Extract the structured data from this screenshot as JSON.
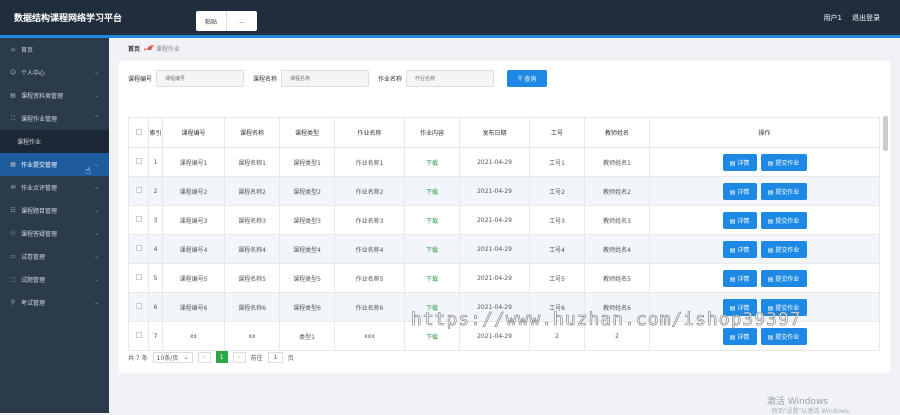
{
  "topbar": {
    "title": "数据结构课程网络学习平台",
    "tabs": [
      "粘贴",
      "..."
    ],
    "user": "用户1",
    "logout": "退出登录"
  },
  "sidebar": {
    "items": [
      {
        "label": "首页",
        "icon": "home-icon",
        "glyph": "⌂"
      },
      {
        "label": "个人中心",
        "icon": "user-icon",
        "glyph": "☺",
        "chev": "⌄"
      },
      {
        "label": "课程资料类管理",
        "icon": "book-icon",
        "glyph": "▤",
        "chev": "⌄"
      },
      {
        "label": "课程作业管理",
        "icon": "task-icon",
        "glyph": "⛶",
        "chev": "⌃"
      },
      {
        "label": "课程作业",
        "sub": true
      },
      {
        "label": "作业提交管理",
        "icon": "submit-icon",
        "glyph": "▦",
        "chev": "⌄",
        "active": true
      },
      {
        "label": "作业点评管理",
        "icon": "comment-icon",
        "glyph": "✉",
        "chev": "⌄"
      },
      {
        "label": "课程题目管理",
        "icon": "question-icon",
        "glyph": "☷",
        "chev": "⌄"
      },
      {
        "label": "课程答疑管理",
        "icon": "qa-icon",
        "glyph": "⚇",
        "chev": "⌄"
      },
      {
        "label": "试卷管理",
        "icon": "paper-icon",
        "glyph": "▭",
        "chev": "⌄"
      },
      {
        "label": "试题管理",
        "icon": "exam-icon",
        "glyph": "⬚",
        "chev": "⌄"
      },
      {
        "label": "考试管理",
        "icon": "test-icon",
        "glyph": "⚲",
        "chev": "⌄"
      }
    ]
  },
  "breadcrumb": {
    "home": "首页",
    "sep": "𝓜",
    "current": "课程作业"
  },
  "search": {
    "course_no_label": "课程编号",
    "course_no_ph": "课程编号",
    "course_name_label": "课程名称",
    "course_name_ph": "课程名称",
    "hw_name_label": "作业名称",
    "hw_name_ph": "作业名称",
    "btn": "查询",
    "btn_icon": "⚲"
  },
  "table": {
    "headers": [
      "",
      "索引",
      "课程编号",
      "课程名称",
      "课程类型",
      "作业名称",
      "作业内容",
      "发布日期",
      "工号",
      "教师姓名",
      "操作"
    ],
    "rows": [
      [
        "1",
        "课程编号1",
        "课程名称1",
        "课程类型1",
        "作业名称1",
        "下载",
        "2021-04-29",
        "工号1",
        "教师姓名1"
      ],
      [
        "2",
        "课程编号2",
        "课程名称2",
        "课程类型2",
        "作业名称2",
        "下载",
        "2021-04-29",
        "工号2",
        "教师姓名2"
      ],
      [
        "3",
        "课程编号3",
        "课程名称3",
        "课程类型3",
        "作业名称3",
        "下载",
        "2021-04-29",
        "工号3",
        "教师姓名3"
      ],
      [
        "4",
        "课程编号4",
        "课程名称4",
        "课程类型4",
        "作业名称4",
        "下载",
        "2021-04-29",
        "工号4",
        "教师姓名4"
      ],
      [
        "5",
        "课程编号5",
        "课程名称5",
        "课程类型5",
        "作业名称5",
        "下载",
        "2021-04-29",
        "工号5",
        "教师姓名5"
      ],
      [
        "6",
        "课程编号6",
        "课程名称6",
        "课程类型6",
        "作业名称6",
        "下载",
        "2021-04-29",
        "工号6",
        "教师姓名6"
      ],
      [
        "7",
        "xx",
        "xx",
        "类型1",
        "xxx",
        "下载",
        "2021-04-29",
        "2",
        "2"
      ]
    ],
    "detail_btn": "▤ 详情",
    "submit_btn": "▤ 提交作业"
  },
  "pager": {
    "total": "共 7 条",
    "size": "10条/页",
    "prev": "‹",
    "page": "1",
    "next": "›",
    "goto": "前往",
    "goto_val": "1",
    "unit": "页",
    "chev": "⌄"
  },
  "watermark": "https://www.huzhan.com/ishop39397",
  "activation": {
    "line1": "激活 Windows",
    "line2": "转到\"设置\"以激活 Windows。"
  }
}
